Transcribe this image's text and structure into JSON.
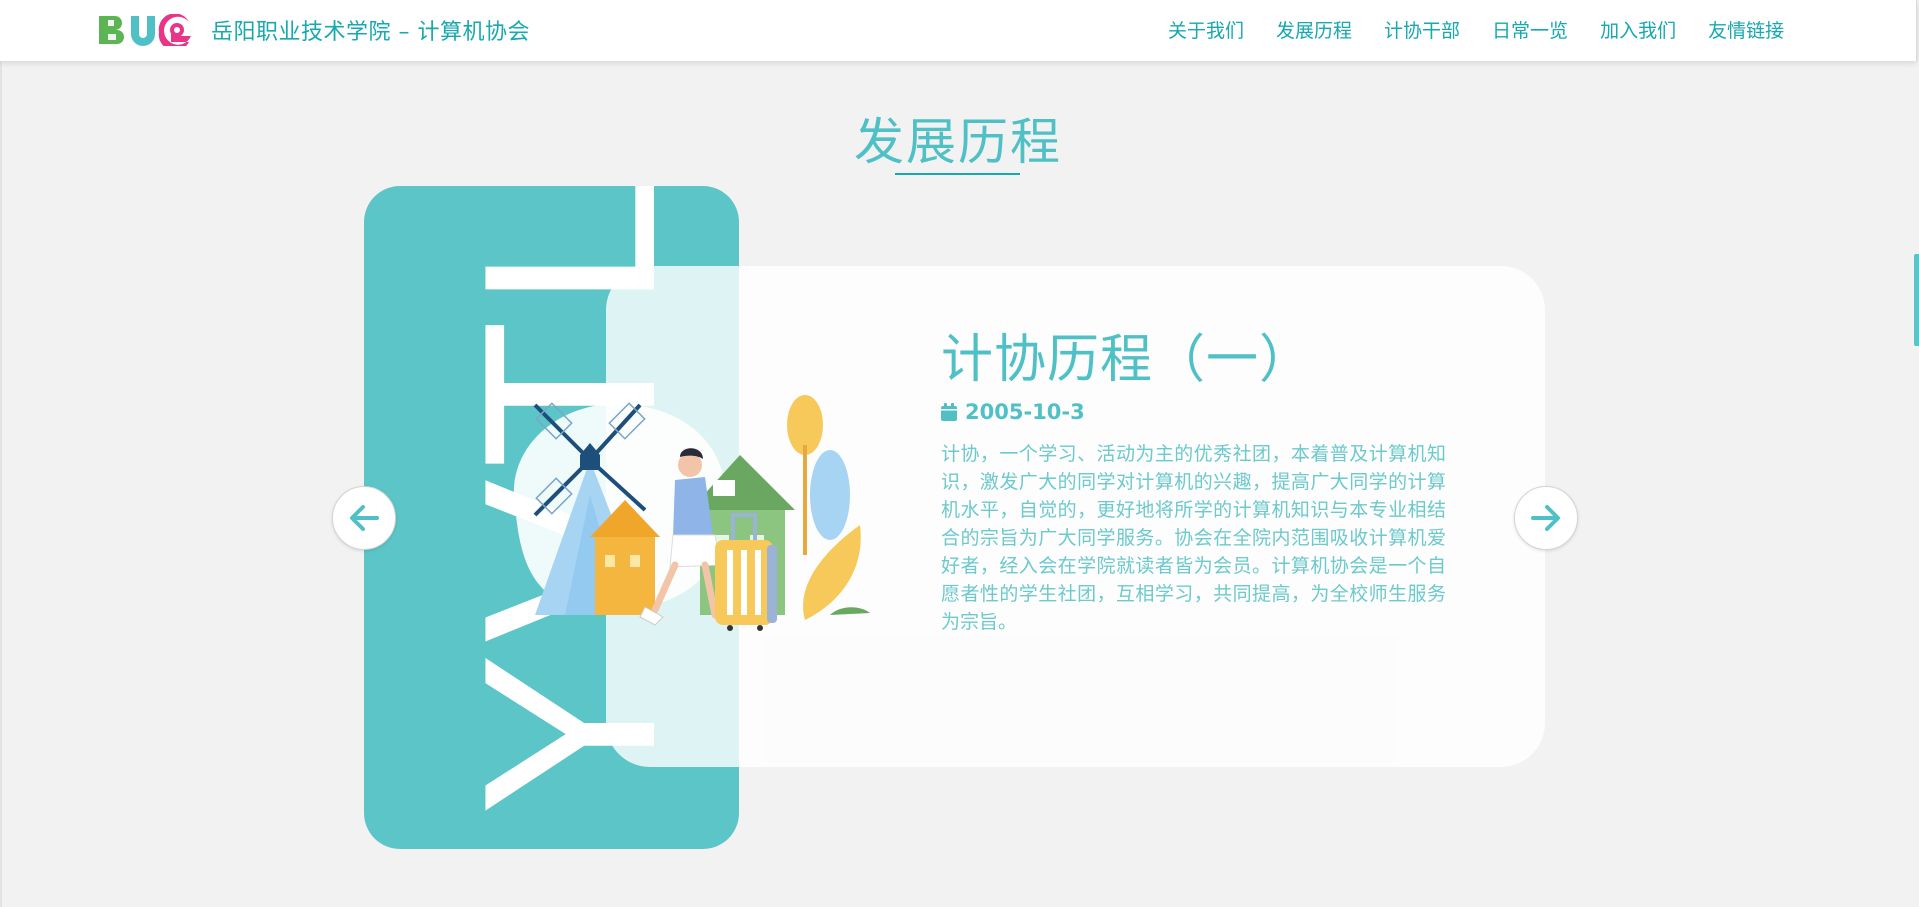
{
  "header": {
    "site_title": "岳阳职业技术学院 – 计算机协会",
    "logo_text": "BUG",
    "nav": [
      {
        "label": "关于我们"
      },
      {
        "label": "发展历程"
      },
      {
        "label": "计协干部"
      },
      {
        "label": "日常一览"
      },
      {
        "label": "加入我们"
      },
      {
        "label": "友情链接"
      }
    ]
  },
  "section": {
    "title": "发展历程"
  },
  "slide": {
    "panel_text": "YVTL",
    "title": "计协历程（一）",
    "date": "2005-10-3",
    "body": "计协，一个学习、活动为主的优秀社团，本着普及计算机知识，激发广大的同学对计算机的兴趣，提高广大同学的计算机水平，自觉的，更好地将所学的计算机知识与本专业相结合的宗旨为广大同学服务。协会在全院内范围吸收计算机爱好者，经入会在学院就读者皆为会员。计算机协会是一个自愿者性的学生社团，互相学习，共同提高，为全校师生服务为宗旨。"
  },
  "colors": {
    "accent": "#4fc1c6",
    "nav_text": "#17a8b0",
    "panel": "#5bc5c8",
    "background": "#f2f2f2"
  },
  "icons": {
    "prev": "arrow-left-icon",
    "next": "arrow-right-icon",
    "date": "calendar-icon"
  }
}
